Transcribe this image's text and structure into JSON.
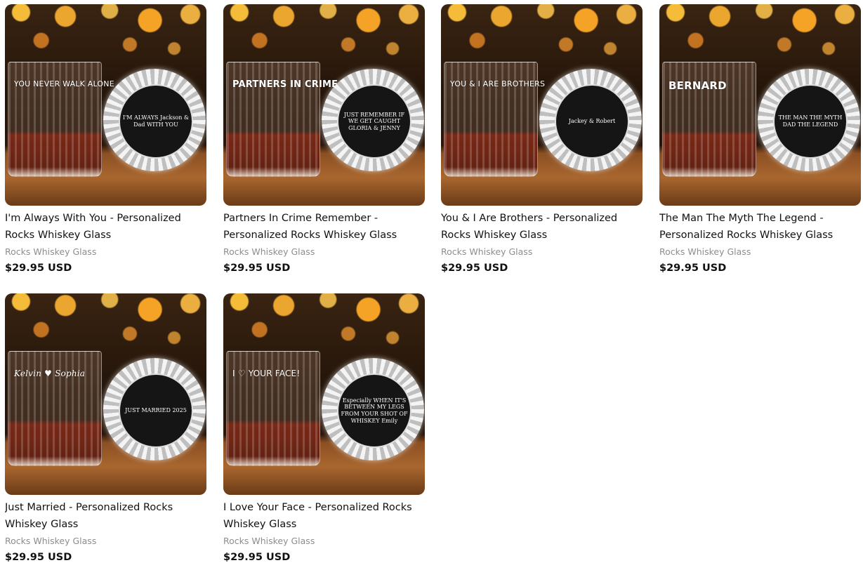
{
  "products": [
    {
      "title": "I'm Always With You - Personalized Rocks Whiskey Glass",
      "type": "Rocks Whiskey Glass",
      "price": "$29.95 USD",
      "glass_text": "YOU NEVER WALK ALONE",
      "coaster_text": "I'M ALWAYS Jackson & Dad WITH YOU"
    },
    {
      "title": "Partners In Crime Remember - Personalized Rocks Whiskey Glass",
      "type": "Rocks Whiskey Glass",
      "price": "$29.95 USD",
      "glass_text": "PARTNERS IN CRIME",
      "coaster_text": "JUST REMEMBER IF WE GET CAUGHT GLORIA & JENNY"
    },
    {
      "title": "You & I Are Brothers - Personalized Rocks Whiskey Glass",
      "type": "Rocks Whiskey Glass",
      "price": "$29.95 USD",
      "glass_text": "YOU & I ARE BROTHERS",
      "coaster_text": "Jackey & Robert"
    },
    {
      "title": "The Man The Myth The Legend - Personalized Rocks Whiskey Glass",
      "type": "Rocks Whiskey Glass",
      "price": "$29.95 USD",
      "glass_text": "BERNARD",
      "coaster_text": "THE MAN THE MYTH DAD THE LEGEND"
    },
    {
      "title": "Just Married - Personalized Rocks Whiskey Glass",
      "type": "Rocks Whiskey Glass",
      "price": "$29.95 USD",
      "glass_text": "Kelvin ♥ Sophia",
      "coaster_text": "JUST MARRIED 2025"
    },
    {
      "title": "I Love Your Face - Personalized Rocks Whiskey Glass",
      "type": "Rocks Whiskey Glass",
      "price": "$29.95 USD",
      "glass_text": "I ♡ YOUR FACE!",
      "coaster_text": "Especially WHEN IT'S BETWEEN MY LEGS FROM YOUR SHOT OF WHISKEY Emily"
    }
  ]
}
